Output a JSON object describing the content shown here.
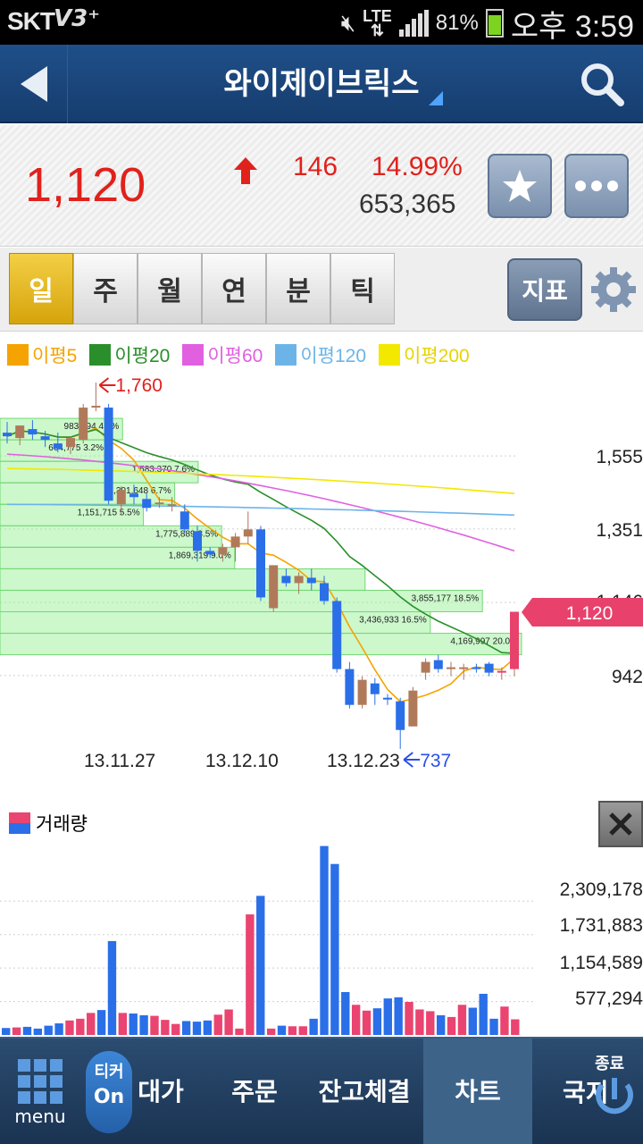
{
  "status_bar": {
    "carrier": "SKT",
    "network": "LTE",
    "battery_pct": "81%",
    "time": "오후 3:59"
  },
  "header": {
    "title": "와이제이브릭스"
  },
  "quote": {
    "price": "1,120",
    "change": "146",
    "change_pct": "14.99%",
    "volume": "653,365",
    "direction": "up",
    "up_color": "#e0211c"
  },
  "period_tabs": [
    "일",
    "주",
    "월",
    "연",
    "분",
    "틱"
  ],
  "active_period": "일",
  "indicator_button": "지표",
  "legend": [
    {
      "label": "이평5",
      "color": "#f5a300"
    },
    {
      "label": "이평20",
      "color": "#2a8f2a"
    },
    {
      "label": "이평60",
      "color": "#e060e0"
    },
    {
      "label": "이평120",
      "color": "#6cb4e8"
    },
    {
      "label": "이평200",
      "color": "#f2e800"
    }
  ],
  "chart_data": [
    {
      "type": "candlestick",
      "title": "",
      "x_tick_labels": [
        "13.11.27",
        "13.12.10",
        "13.12.23"
      ],
      "y_tick_labels": [
        "1,555",
        "1,351",
        "1,146",
        "942"
      ],
      "ylim": [
        737,
        1760
      ],
      "current_price_label": "1,120",
      "high_marker": "1,760",
      "low_marker": "737",
      "candles": [
        {
          "o": 1620,
          "h": 1650,
          "l": 1590,
          "c": 1610
        },
        {
          "o": 1605,
          "h": 1640,
          "l": 1585,
          "c": 1640
        },
        {
          "o": 1630,
          "h": 1655,
          "l": 1600,
          "c": 1615
        },
        {
          "o": 1610,
          "h": 1625,
          "l": 1580,
          "c": 1600
        },
        {
          "o": 1590,
          "h": 1620,
          "l": 1565,
          "c": 1575
        },
        {
          "o": 1580,
          "h": 1610,
          "l": 1560,
          "c": 1605
        },
        {
          "o": 1600,
          "h": 1700,
          "l": 1590,
          "c": 1690
        },
        {
          "o": 1690,
          "h": 1760,
          "l": 1680,
          "c": 1695
        },
        {
          "o": 1690,
          "h": 1700,
          "l": 1420,
          "c": 1430
        },
        {
          "o": 1420,
          "h": 1470,
          "l": 1390,
          "c": 1460
        },
        {
          "o": 1450,
          "h": 1475,
          "l": 1420,
          "c": 1440
        },
        {
          "o": 1435,
          "h": 1450,
          "l": 1400,
          "c": 1410
        },
        {
          "o": 1420,
          "h": 1440,
          "l": 1410,
          "c": 1425
        },
        {
          "o": 1420,
          "h": 1440,
          "l": 1400,
          "c": 1420
        },
        {
          "o": 1400,
          "h": 1420,
          "l": 1340,
          "c": 1350
        },
        {
          "o": 1345,
          "h": 1360,
          "l": 1260,
          "c": 1290
        },
        {
          "o": 1290,
          "h": 1300,
          "l": 1270,
          "c": 1280
        },
        {
          "o": 1280,
          "h": 1310,
          "l": 1260,
          "c": 1300
        },
        {
          "o": 1300,
          "h": 1340,
          "l": 1260,
          "c": 1330
        },
        {
          "o": 1330,
          "h": 1400,
          "l": 1310,
          "c": 1350
        },
        {
          "o": 1350,
          "h": 1360,
          "l": 1150,
          "c": 1160
        },
        {
          "o": 1130,
          "h": 1250,
          "l": 1120,
          "c": 1250
        },
        {
          "o": 1220,
          "h": 1240,
          "l": 1190,
          "c": 1200
        },
        {
          "o": 1200,
          "h": 1230,
          "l": 1170,
          "c": 1220
        },
        {
          "o": 1215,
          "h": 1240,
          "l": 1180,
          "c": 1200
        },
        {
          "o": 1200,
          "h": 1220,
          "l": 1140,
          "c": 1150
        },
        {
          "o": 1150,
          "h": 1160,
          "l": 950,
          "c": 960
        },
        {
          "o": 960,
          "h": 980,
          "l": 850,
          "c": 860
        },
        {
          "o": 860,
          "h": 940,
          "l": 850,
          "c": 930
        },
        {
          "o": 920,
          "h": 935,
          "l": 860,
          "c": 890
        },
        {
          "o": 880,
          "h": 890,
          "l": 860,
          "c": 875
        },
        {
          "o": 870,
          "h": 880,
          "l": 737,
          "c": 790
        },
        {
          "o": 800,
          "h": 910,
          "l": 800,
          "c": 900
        },
        {
          "o": 950,
          "h": 990,
          "l": 930,
          "c": 980
        },
        {
          "o": 985,
          "h": 1000,
          "l": 950,
          "c": 960
        },
        {
          "o": 960,
          "h": 980,
          "l": 940,
          "c": 965
        },
        {
          "o": 960,
          "h": 975,
          "l": 930,
          "c": 965
        },
        {
          "o": 965,
          "h": 975,
          "l": 950,
          "c": 960
        },
        {
          "o": 975,
          "h": 980,
          "l": 940,
          "c": 950
        },
        {
          "o": 950,
          "h": 965,
          "l": 930,
          "c": 955
        },
        {
          "o": 960,
          "h": 1120,
          "l": 940,
          "c": 1120
        }
      ],
      "volume_profile": [
        {
          "label": "983,294 4.7%",
          "low": 1600,
          "high": 1660
        },
        {
          "label": "664,775 3.2%",
          "low": 1540,
          "high": 1600
        },
        {
          "label": "1,583,370 7.6%",
          "low": 1480,
          "high": 1540
        },
        {
          "label": "1,391,648 6.7%",
          "low": 1420,
          "high": 1480
        },
        {
          "label": "1,151,715 5.5%",
          "low": 1360,
          "high": 1420
        },
        {
          "label": "1,775,889 8.5%",
          "low": 1300,
          "high": 1360
        },
        {
          "label": "1,869,319 9.0%",
          "low": 1240,
          "high": 1300
        },
        {
          "label": "",
          "low": 1180,
          "high": 1240
        },
        {
          "label": "3,855,177 18.5%",
          "low": 1120,
          "high": 1180
        },
        {
          "label": "3,436,933 16.5%",
          "low": 1060,
          "high": 1120
        },
        {
          "label": "4,169,997 20.0%",
          "low": 1000,
          "high": 1060
        }
      ]
    },
    {
      "type": "bar",
      "title": "거래량",
      "y_tick_labels": [
        "2,309,178",
        "1,731,883",
        "1,154,589",
        "577,294"
      ],
      "ylim": [
        0,
        3300000
      ],
      "values": [
        120000,
        130000,
        140000,
        110000,
        160000,
        200000,
        250000,
        280000,
        380000,
        430000,
        1620000,
        380000,
        370000,
        340000,
        330000,
        260000,
        190000,
        240000,
        230000,
        250000,
        350000,
        440000,
        110000,
        2080000,
        2400000,
        110000,
        160000,
        150000,
        150000,
        280000,
        3260000,
        2950000,
        740000,
        520000,
        420000,
        460000,
        630000,
        650000,
        570000,
        440000,
        410000,
        340000,
        310000,
        520000,
        470000,
        710000,
        280000,
        490000,
        270000
      ],
      "colors_by_direction": {
        "up": "#ea4470",
        "down": "#2a6fe8"
      }
    }
  ],
  "bottom_nav": {
    "menu": "menu",
    "ticker_top": "티커",
    "ticker_bottom": "On",
    "items": [
      "대가",
      "주문",
      "잔고체결",
      "차트"
    ],
    "active": "차트",
    "partial_item": "국지",
    "exit": "종료"
  }
}
